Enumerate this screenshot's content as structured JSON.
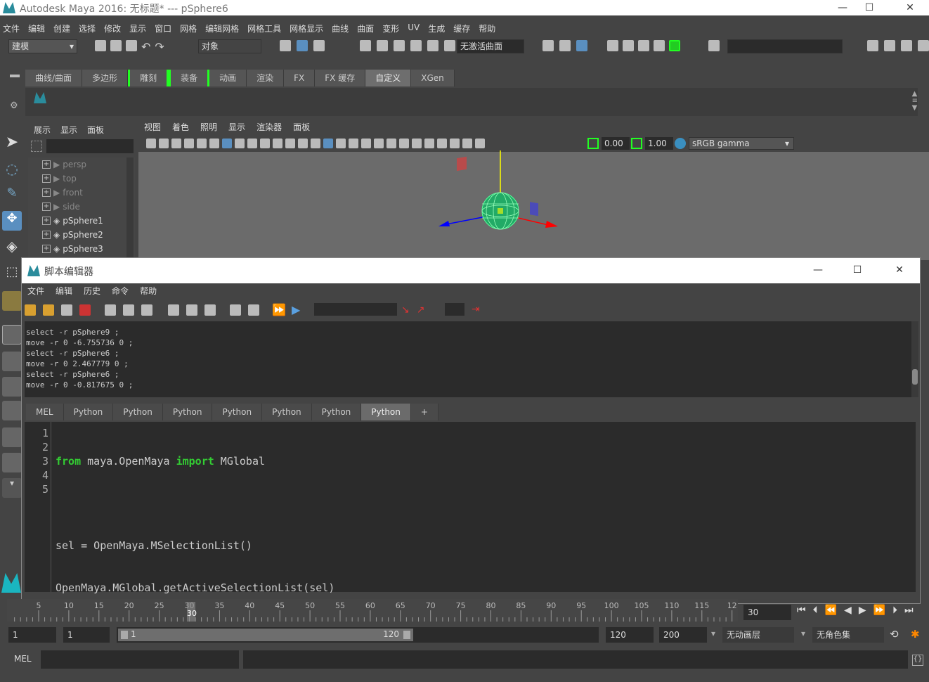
{
  "window": {
    "title": "Autodesk Maya 2016: 无标题*   ---   pSphere6",
    "minimize": "—",
    "maximize": "☐",
    "close": "✕"
  },
  "menubar": [
    "文件",
    "编辑",
    "创建",
    "选择",
    "修改",
    "显示",
    "窗口",
    "网格",
    "编辑网格",
    "网格工具",
    "网格显示",
    "曲线",
    "曲面",
    "变形",
    "UV",
    "生成",
    "缓存",
    "帮助"
  ],
  "status_line": {
    "mode": "建模",
    "selection_mode": "对象",
    "live_surface": "无激活曲面"
  },
  "shelf_tabs": [
    {
      "label": "曲线/曲面",
      "active": false
    },
    {
      "label": "多边形",
      "active": false
    },
    {
      "label": "雕刻",
      "active": false,
      "bracket": true
    },
    {
      "label": "装备",
      "active": false,
      "bracket": true
    },
    {
      "label": "动画",
      "active": false
    },
    {
      "label": "渲染",
      "active": false
    },
    {
      "label": "FX",
      "active": false
    },
    {
      "label": "FX 缓存",
      "active": false
    },
    {
      "label": "自定义",
      "active": true
    },
    {
      "label": "XGen",
      "active": false
    }
  ],
  "outliner": {
    "menu": [
      "展示",
      "显示",
      "面板"
    ],
    "items": [
      {
        "label": "persp",
        "type": "camera",
        "dim": true
      },
      {
        "label": "top",
        "type": "camera",
        "dim": true
      },
      {
        "label": "front",
        "type": "camera",
        "dim": true
      },
      {
        "label": "side",
        "type": "camera",
        "dim": true
      },
      {
        "label": "pSphere1",
        "type": "mesh",
        "dim": false
      },
      {
        "label": "pSphere2",
        "type": "mesh",
        "dim": false
      },
      {
        "label": "pSphere3",
        "type": "mesh",
        "dim": false
      }
    ]
  },
  "viewport": {
    "menu": [
      "视图",
      "着色",
      "照明",
      "显示",
      "渲染器",
      "面板"
    ],
    "exposure": "0.00",
    "gamma": "1.00",
    "color_space": "sRGB gamma"
  },
  "script_editor": {
    "title": "脚本编辑器",
    "menu": [
      "文件",
      "编辑",
      "历史",
      "命令",
      "帮助"
    ],
    "history": [
      "select -r pSphere9 ;",
      "move -r 0 -6.755736 0 ;",
      "select -r pSphere6 ;",
      "move -r 0 2.467779 0 ;",
      "select -r pSphere6 ;",
      "move -r 0 -0.817675 0 ;"
    ],
    "tabs": [
      {
        "label": "MEL",
        "active": false
      },
      {
        "label": "Python",
        "active": false
      },
      {
        "label": "Python",
        "active": false
      },
      {
        "label": "Python",
        "active": false
      },
      {
        "label": "Python",
        "active": false
      },
      {
        "label": "Python",
        "active": false
      },
      {
        "label": "Python",
        "active": false
      },
      {
        "label": "Python",
        "active": true
      },
      {
        "label": "+",
        "active": false
      }
    ],
    "line_numbers": [
      "1",
      "2",
      "3",
      "4",
      "5"
    ],
    "code": {
      "l1_kw1": "from",
      "l1_mod": " maya.OpenMaya ",
      "l1_kw2": "import",
      "l1_name": " MGlobal",
      "l3": "sel = OpenMaya.MSelectionList()",
      "l4": "OpenMaya.MGlobal.getActiveSelectionList(sel)"
    }
  },
  "timeline": {
    "ticks": [
      "5",
      "10",
      "15",
      "20",
      "25",
      "30",
      "35",
      "40",
      "45",
      "50",
      "55",
      "60",
      "65",
      "70",
      "75",
      "80",
      "85",
      "90",
      "95",
      "100",
      "105",
      "110",
      "115",
      "12"
    ],
    "current_frame_label": "30",
    "current_frame": "30"
  },
  "range": {
    "start": "1",
    "playback_start": "1",
    "slider_start": "1",
    "slider_end": "120",
    "playback_end": "120",
    "end": "200",
    "anim_layer": "无动画层",
    "character_set": "无角色集"
  },
  "command_line": {
    "lang": "MEL"
  }
}
